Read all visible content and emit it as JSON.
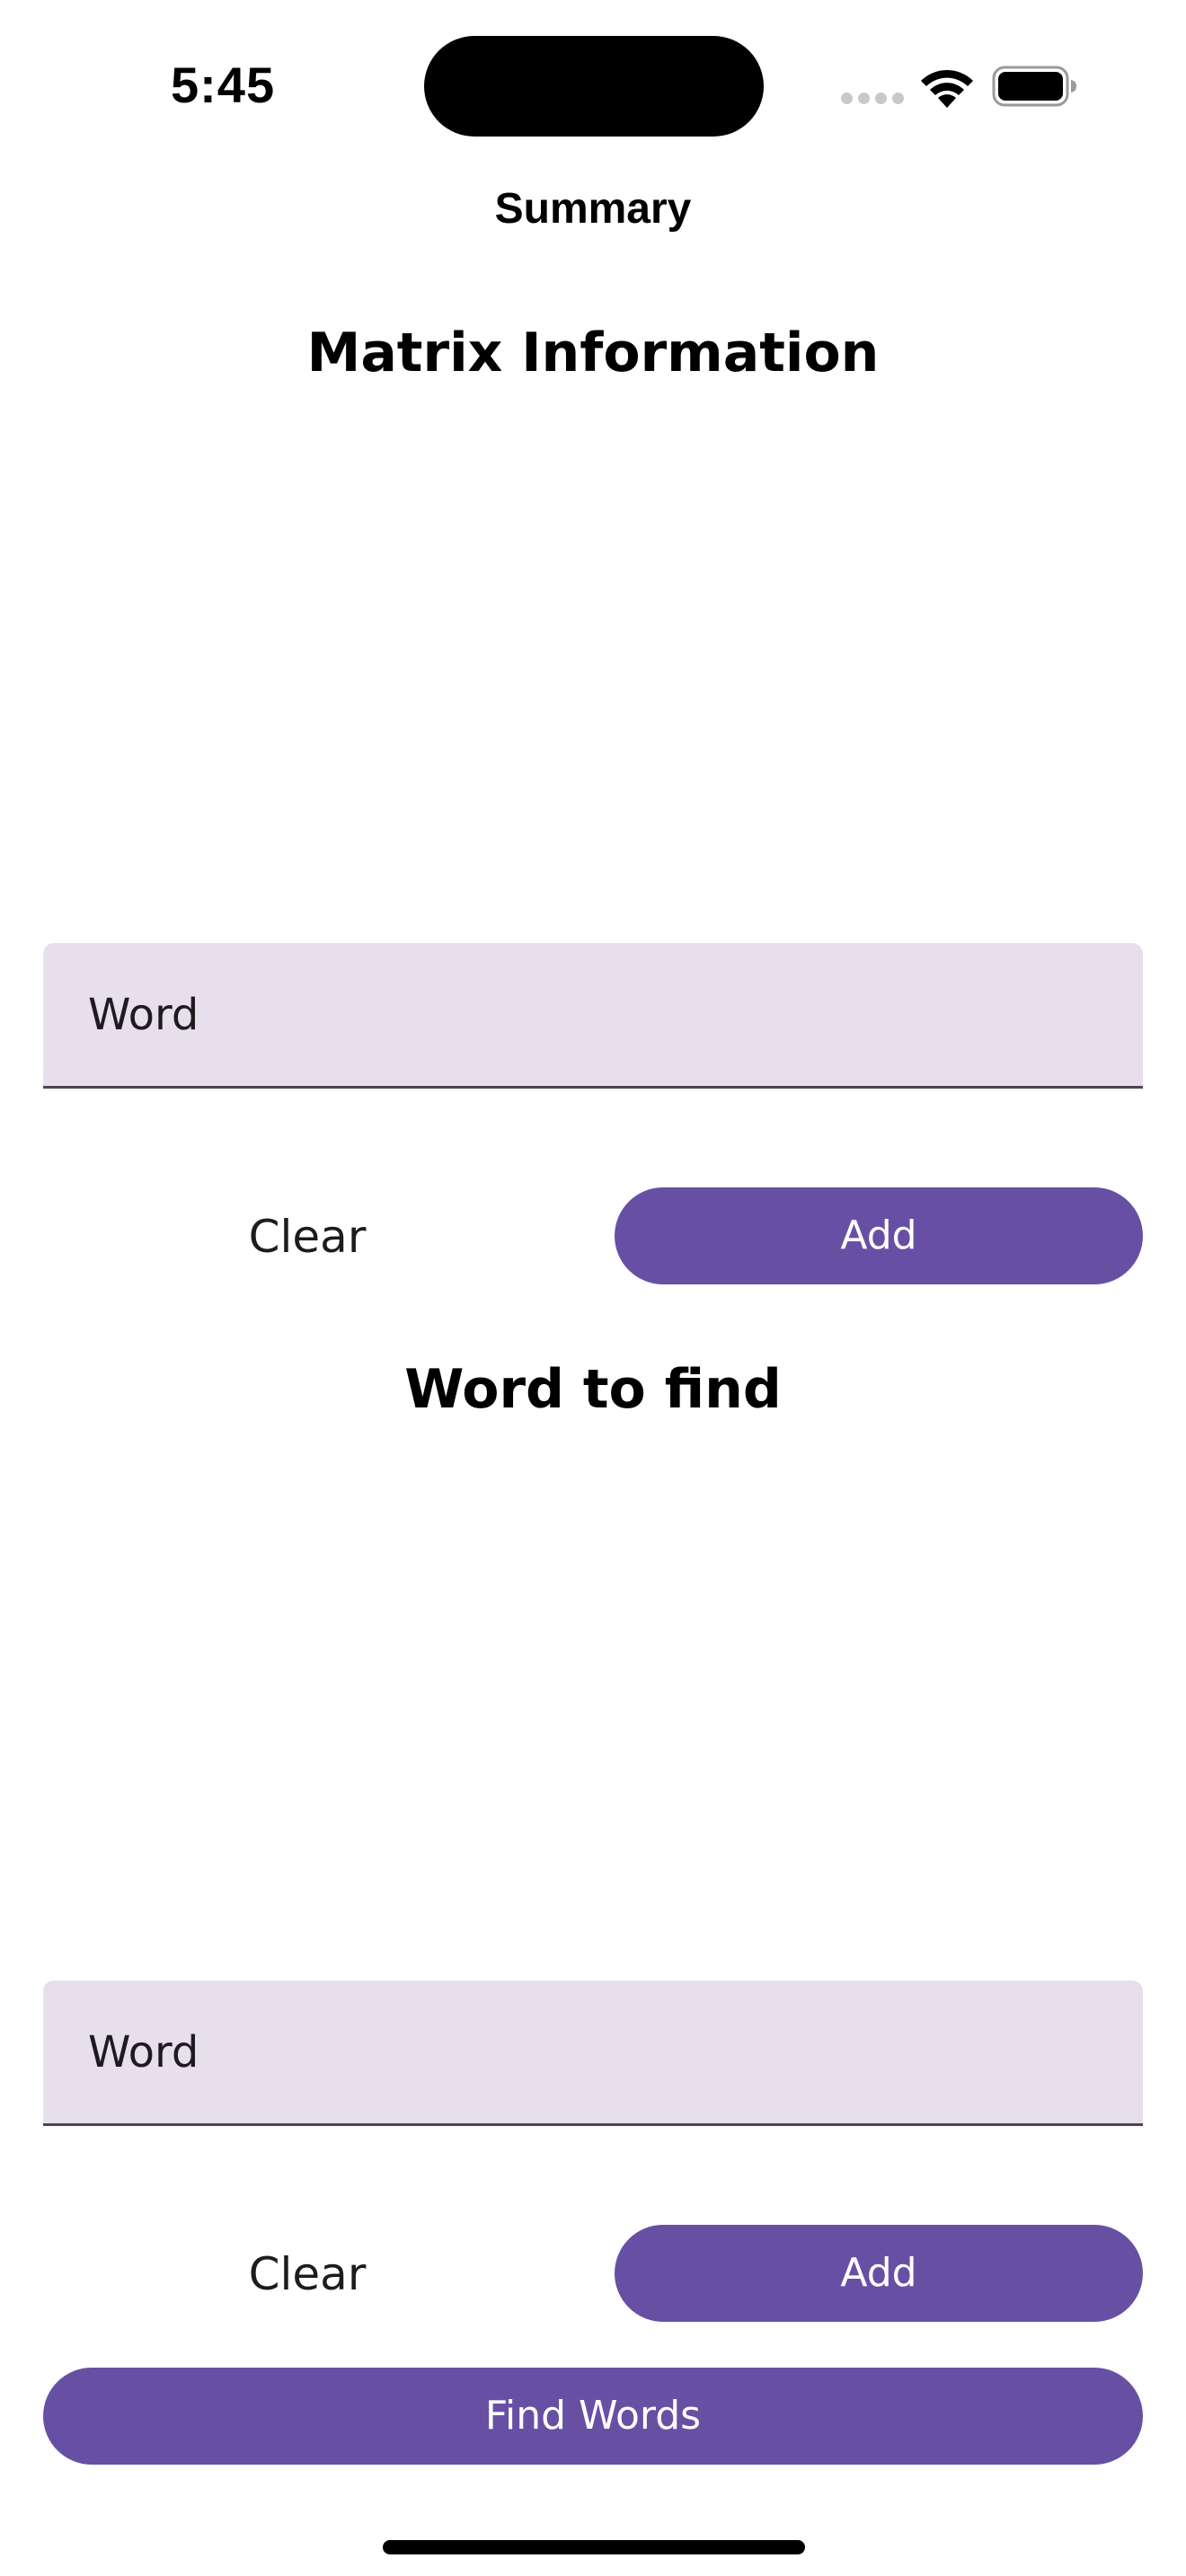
{
  "status_bar": {
    "time": "5:45",
    "icons": [
      "cellular-signal-icon",
      "wifi-icon",
      "battery-icon"
    ]
  },
  "nav": {
    "title": "Summary"
  },
  "matrix_section": {
    "heading": "Matrix Information",
    "word_field": {
      "placeholder": "Word",
      "value": ""
    },
    "clear_label": "Clear",
    "add_label": "Add"
  },
  "find_section": {
    "heading": "Word to find",
    "word_field": {
      "placeholder": "Word",
      "value": ""
    },
    "clear_label": "Clear",
    "add_label": "Add"
  },
  "find_words_label": "Find Words",
  "colors": {
    "accent": "#6750a4",
    "field_background": "#e8dfec",
    "field_underline": "#4a4458",
    "text": "#1d1b20"
  }
}
